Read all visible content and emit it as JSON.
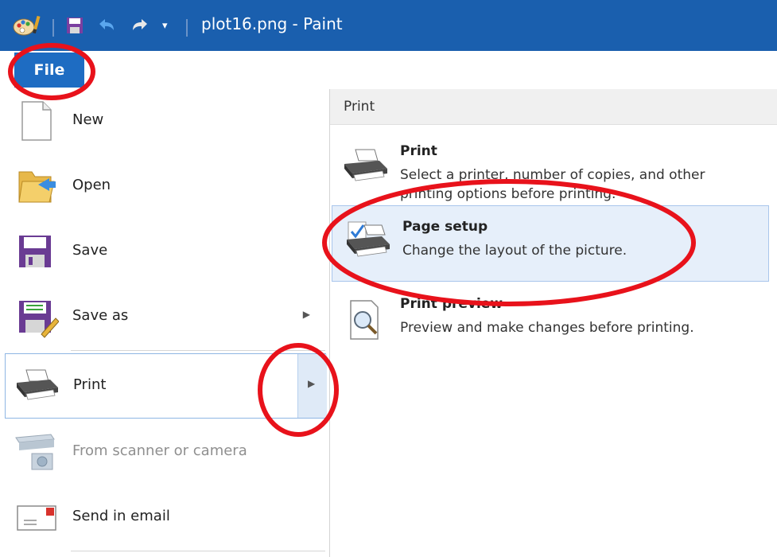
{
  "window": {
    "title": "plot16.png - Paint"
  },
  "quick_access": {
    "paint_icon": "paint-app-icon",
    "save_icon": "save-icon",
    "undo_icon": "undo-icon",
    "redo_icon": "redo-icon",
    "customize_icon": "customize-dropdown-icon",
    "customize_glyph": "▾"
  },
  "ribbon": {
    "file_tab": "File"
  },
  "left_menu": {
    "items": [
      {
        "label": "New",
        "icon": "new-document-icon"
      },
      {
        "label": "Open",
        "icon": "open-folder-icon"
      },
      {
        "label": "Save",
        "icon": "save-disk-icon"
      },
      {
        "label": "Save as",
        "icon": "save-as-icon",
        "arrow": "▶"
      },
      {
        "label": "Print",
        "icon": "printer-icon",
        "arrow": "▶"
      },
      {
        "label": "From scanner or camera",
        "icon": "scanner-icon"
      },
      {
        "label": "Send in email",
        "icon": "email-icon"
      }
    ]
  },
  "print_panel": {
    "header": "Print",
    "items": [
      {
        "title": "Print",
        "description": "Select a printer, number of copies, and other printing options before printing.",
        "icon": "printer-icon"
      },
      {
        "title": "Page setup",
        "description": "Change the layout of the picture.",
        "icon": "page-setup-icon"
      },
      {
        "title": "Print preview",
        "description": "Preview and make changes before printing.",
        "icon": "print-preview-icon"
      }
    ]
  },
  "colors": {
    "titlebar": "#1a5fae",
    "file_tab": "#1e6cc2",
    "highlight": "#e6effa",
    "annotation": "#e8121b"
  }
}
